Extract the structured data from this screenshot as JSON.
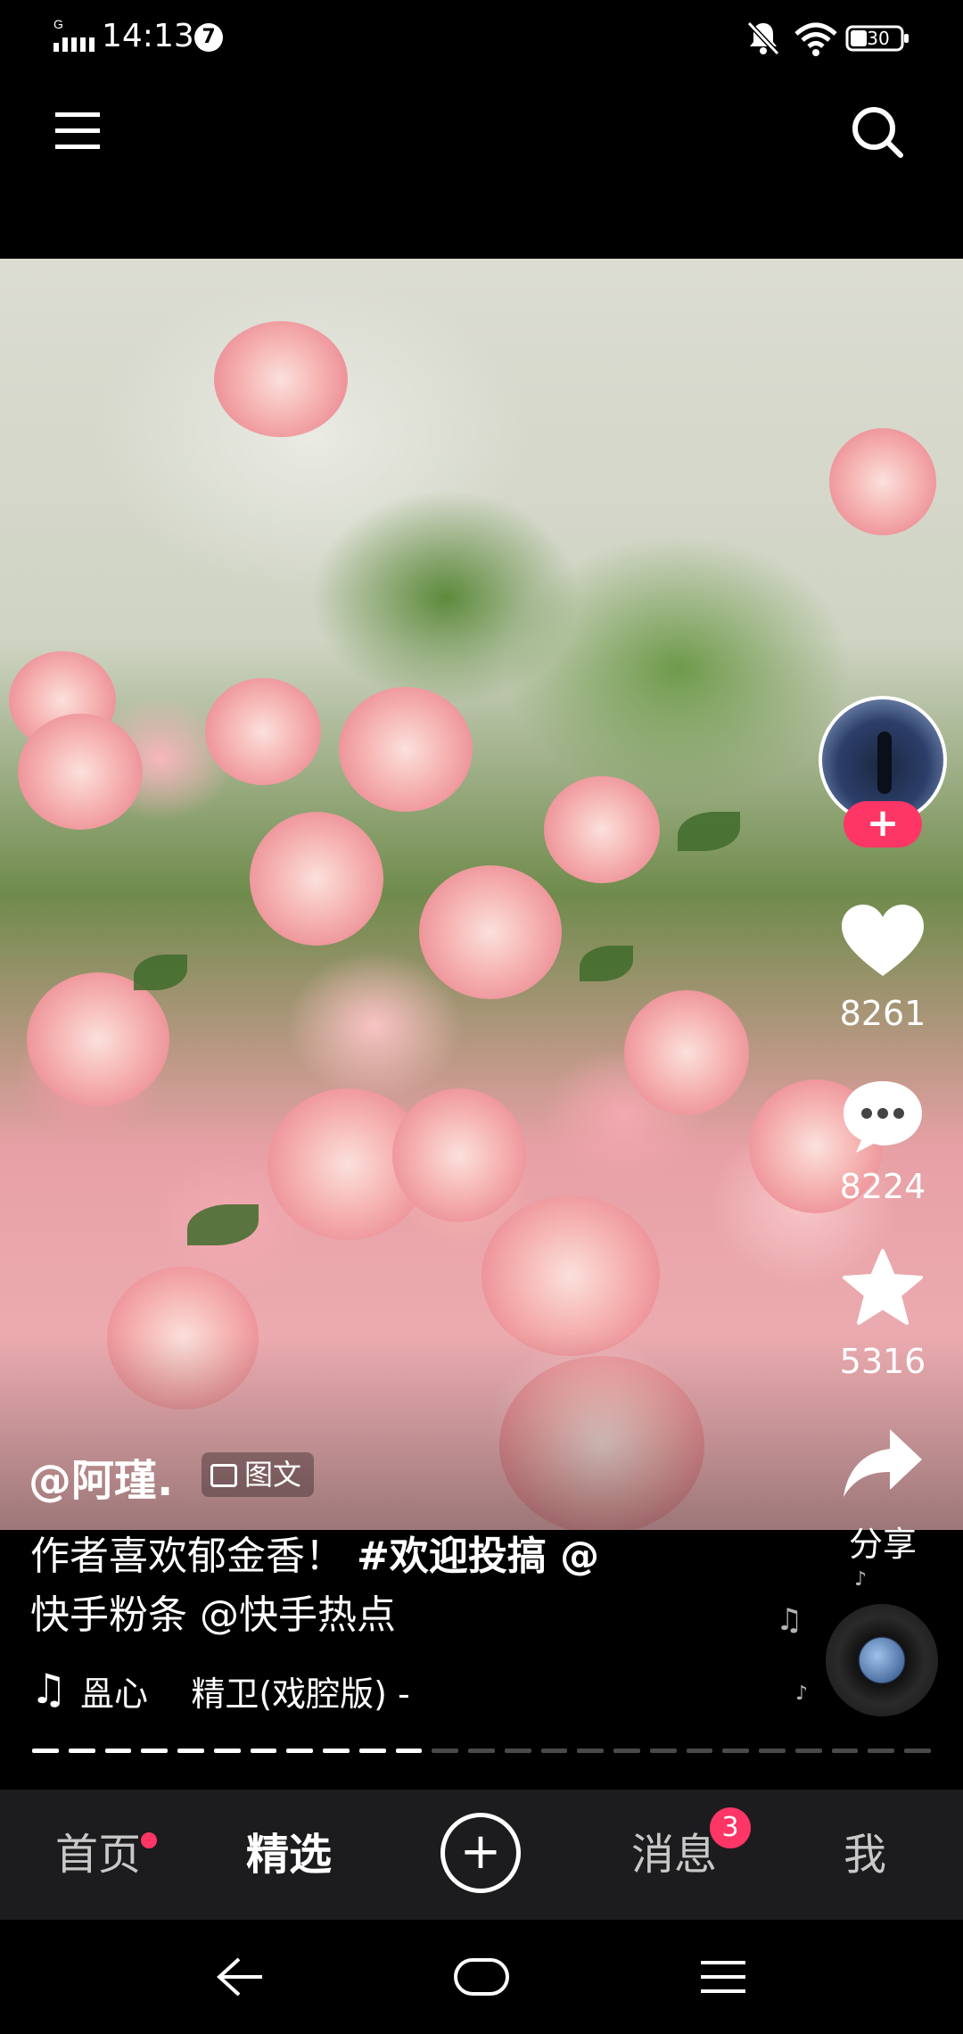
{
  "status_bar": {
    "time": "14:13",
    "notification_count": "7",
    "network_label": "G",
    "battery": "30"
  },
  "post": {
    "author": "@阿瑾.",
    "type_label": "图文",
    "caption_text": "作者喜欢郁金香！ ",
    "caption_tag": "#欢迎投搞 @",
    "caption_line2": "快手粉条 @快手热点",
    "music": "𥁕心    精卫(戏腔版) -",
    "likes": "8261",
    "comments": "8224",
    "favorites": "5316",
    "share_label": "分享",
    "follow_symbol": "+",
    "progress": {
      "total_segments": 25,
      "watched_segments": 11
    }
  },
  "bottom_nav": {
    "home": "首页",
    "featured": "精选",
    "plus": "+",
    "messages": "消息",
    "messages_badge": "3",
    "me": "我"
  },
  "colors": {
    "accent": "#fe3666",
    "nav_bg": "#1c1c1e"
  },
  "icons": {
    "menu": "menu-icon",
    "search": "search-icon",
    "like": "heart-icon",
    "comment": "comment-icon",
    "favorite": "star-icon",
    "share": "share-icon",
    "music": "music-note-icon"
  }
}
